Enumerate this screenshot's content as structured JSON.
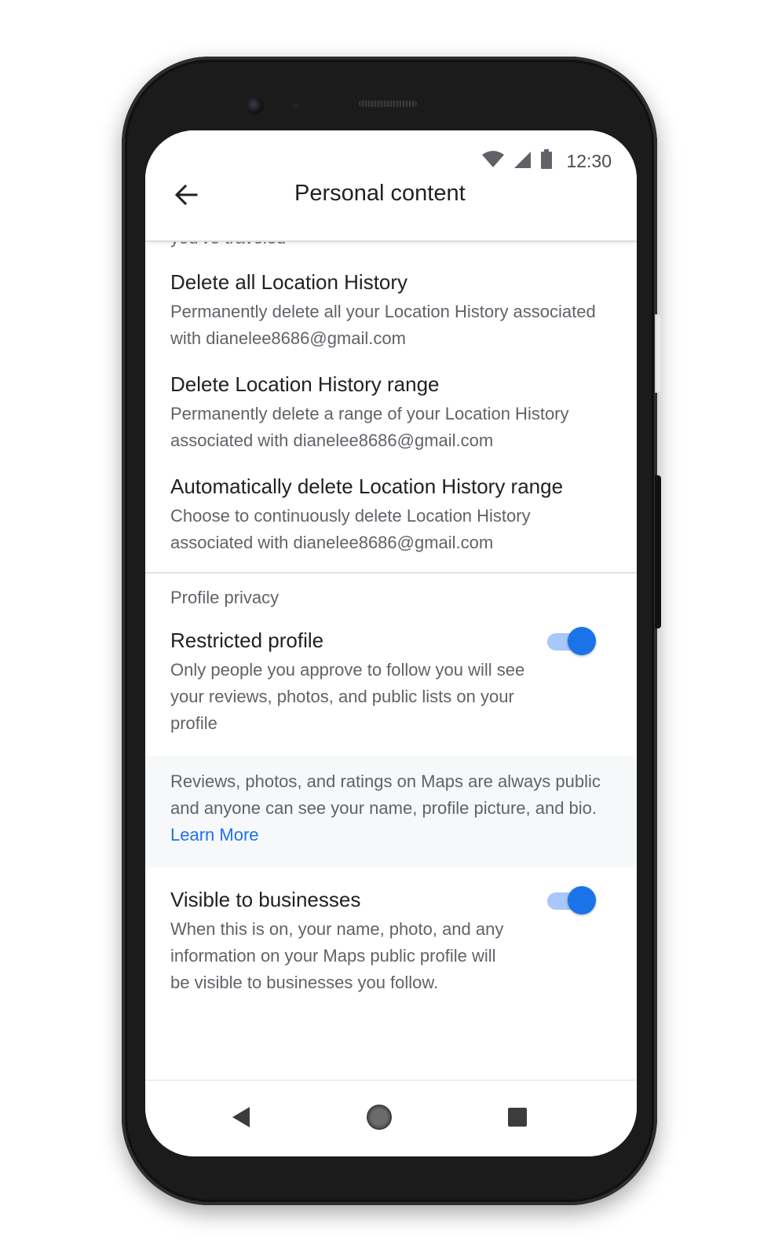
{
  "status_bar": {
    "time": "12:30",
    "icons": [
      "wifi-icon",
      "cellular-signal-icon",
      "battery-icon"
    ]
  },
  "app_bar": {
    "title": "Personal content",
    "back_icon": "arrow-back-icon"
  },
  "partial_row_text": "you've traveled",
  "location_items": [
    {
      "title": "Delete all Location History",
      "description": "Permanently delete all your Location History associated with dianelee8686@gmail.com"
    },
    {
      "title": "Delete Location History range",
      "description": "Permanently delete a range of your Location History associated with dianelee8686@gmail.com"
    },
    {
      "title": "Automatically delete Location History range",
      "description": "Choose to continuously delete Location History associated with dianelee8686@gmail.com"
    }
  ],
  "profile_privacy": {
    "section_title": "Profile privacy",
    "restricted_profile": {
      "title": "Restricted profile",
      "description": "Only people you approve to follow you will see your reviews, photos, and public lists on your profile",
      "enabled": true
    },
    "info_note": {
      "text": "Reviews, photos, and ratings on Maps are always public and anyone can see your name, profile picture, and bio.",
      "link_label": "Learn More"
    },
    "visible_to_businesses": {
      "title": "Visible to businesses",
      "description": "When this is on, your name, photo, and any information on your Maps public profile will be visible to businesses you follow.",
      "enabled": true
    }
  },
  "nav_bar": {
    "icons": [
      "back-triangle-icon",
      "home-circle-icon",
      "recents-square-icon"
    ]
  },
  "colors": {
    "accent": "#1a73e8",
    "toggle_track": "#a8c7fa",
    "primary_text": "#202124",
    "secondary_text": "#5f6368"
  }
}
